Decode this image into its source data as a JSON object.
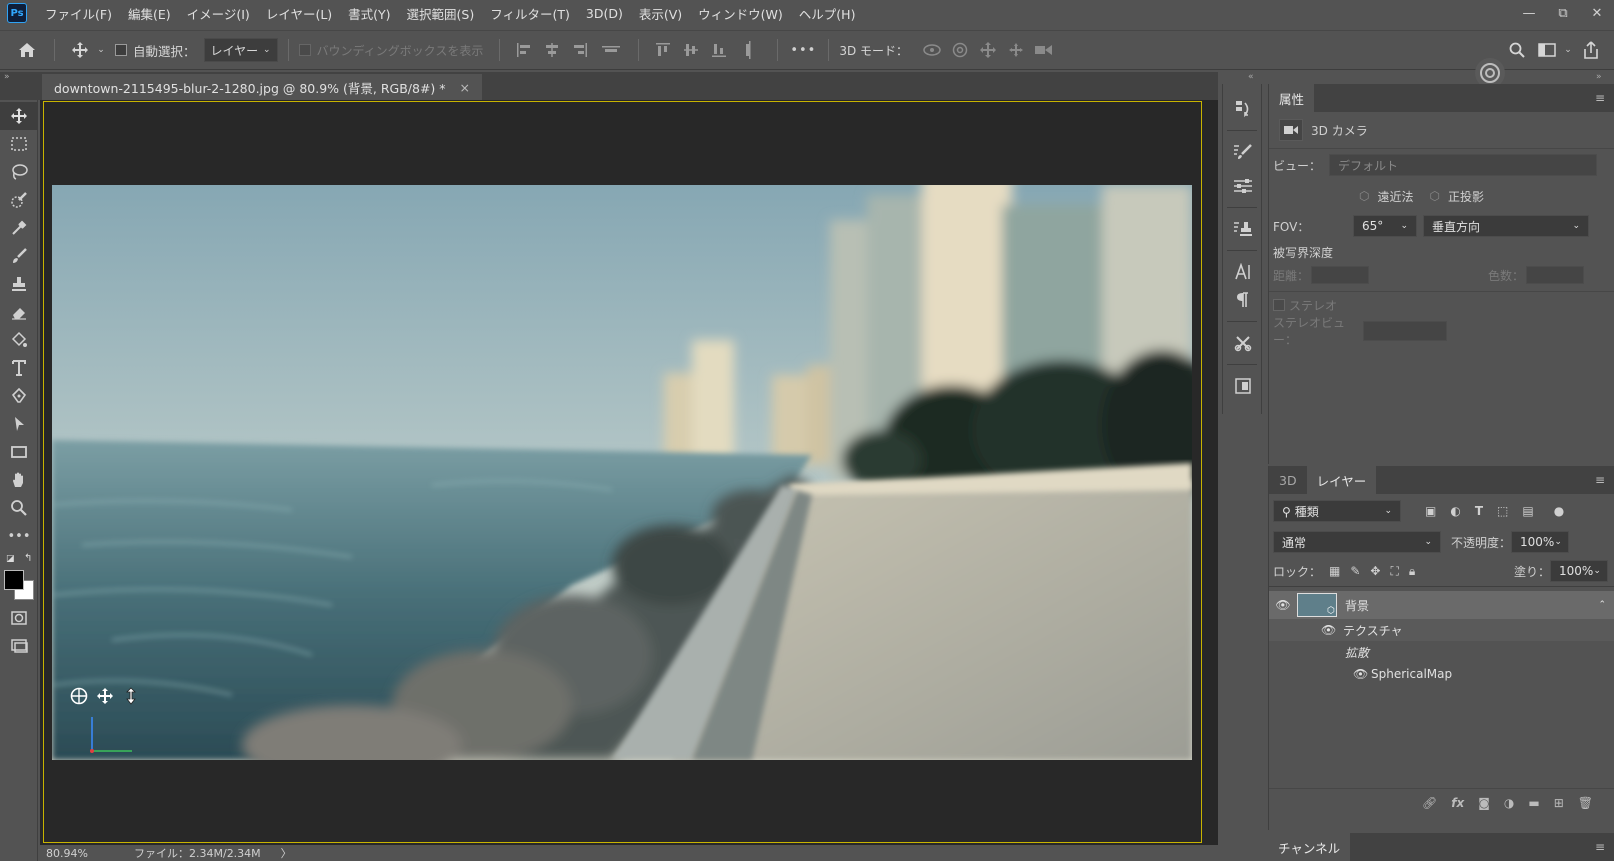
{
  "app": {
    "logo": "Ps"
  },
  "menu": [
    "ファイル(F)",
    "編集(E)",
    "イメージ(I)",
    "レイヤー(L)",
    "書式(Y)",
    "選択範囲(S)",
    "フィルター(T)",
    "3D(D)",
    "表示(V)",
    "ウィンドウ(W)",
    "ヘルプ(H)"
  ],
  "window_controls": {
    "minimize": "—",
    "restore": "⧉",
    "close": "✕"
  },
  "options_bar": {
    "auto_select_label": "自動選択：",
    "auto_select_target": "レイヤー",
    "bounding_box_label": "バウンディングボックスを表示",
    "more": "•••",
    "mode_3d_label": "3D モード："
  },
  "document": {
    "tab_title": "downtown-2115495-blur-2-1280.jpg @ 80.9% (背景, RGB/8#) *",
    "tab_close": "×",
    "zoom": "80.94%",
    "file_info": "ファイル：2.34M/2.34M",
    "status_arrow": "〉"
  },
  "properties": {
    "tab": "属性",
    "object_type": "3D カメラ",
    "view_label": "ビュー：",
    "view_placeholder": "デフォルト",
    "perspective_label": "遠近法",
    "orthographic_label": "正投影",
    "fov_label": "FOV：",
    "fov_value": "65°",
    "fov_direction": "垂直方向",
    "dof_label": "被写界深度",
    "distance_label": "距離：",
    "blur_label": "色数：",
    "stereo_label": "ステレオ",
    "stereo_view_label": "ステレオビュー："
  },
  "layers_panel": {
    "tabs": [
      "3D",
      "レイヤー"
    ],
    "filter_kind": "種類",
    "blend_mode": "通常",
    "opacity_label": "不透明度：",
    "opacity_value": "100%",
    "lock_label": "ロック：",
    "fill_label": "塗り：",
    "fill_value": "100%",
    "layers": [
      {
        "name": "背景",
        "visible": true,
        "level": 0
      },
      {
        "name": "テクスチャ",
        "visible": true,
        "level": 1
      },
      {
        "name": "拡散",
        "visible": false,
        "level": 2
      },
      {
        "name": "SphericalMap",
        "visible": true,
        "level": 3
      }
    ]
  },
  "bottom_panel": {
    "tab": "チャンネル"
  },
  "colors": {
    "accent": "#31a8ff",
    "doc_border": "#c8b400",
    "panel_bg": "#535353",
    "canvas_bg": "#282828"
  }
}
